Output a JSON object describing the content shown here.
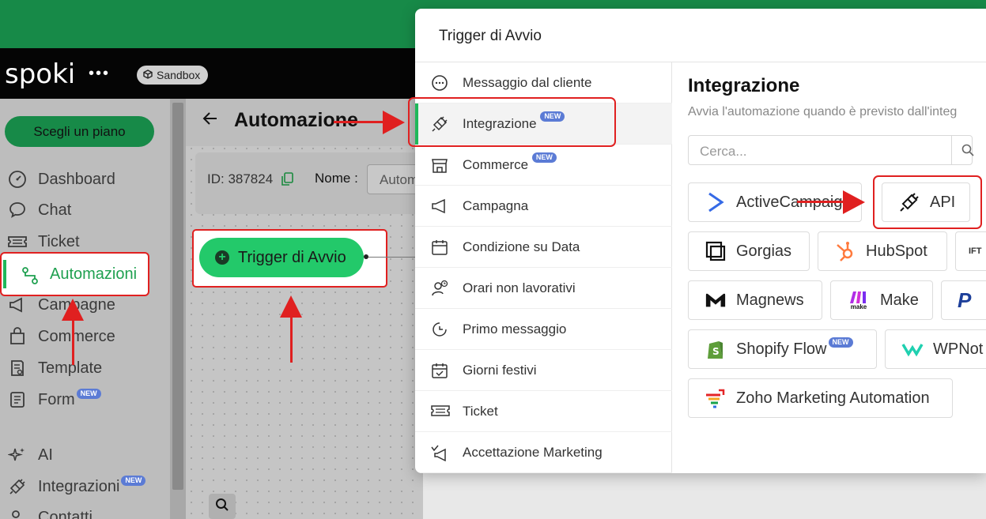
{
  "brand": {
    "logo": "spoki",
    "logo_dots": "•••",
    "env_badge": "Sandbox"
  },
  "sidebar": {
    "plan_button": "Scegli un piano",
    "items": [
      {
        "label": "Dashboard",
        "icon": "gauge-icon"
      },
      {
        "label": "Chat",
        "icon": "chat-icon"
      },
      {
        "label": "Ticket",
        "icon": "ticket-icon"
      },
      {
        "label": "Automazioni",
        "icon": "automation-icon",
        "active": true
      },
      {
        "label": "Campagne",
        "icon": "megaphone-icon"
      },
      {
        "label": "Commerce",
        "icon": "bag-icon"
      },
      {
        "label": "Template",
        "icon": "template-icon"
      },
      {
        "label": "Form",
        "icon": "form-icon",
        "badge": "NEW"
      },
      {
        "label": "AI",
        "icon": "sparkle-icon"
      },
      {
        "label": "Integrazioni",
        "icon": "plug-icon",
        "badge": "NEW"
      },
      {
        "label": "Contatti",
        "icon": "contacts-icon"
      }
    ]
  },
  "main": {
    "title": "Automazione",
    "id_label": "ID: 387824",
    "name_label": "Nome :",
    "name_value": "Autom",
    "trigger_button": "Trigger di Avvio"
  },
  "modal": {
    "title": "Trigger di Avvio",
    "triggers": [
      {
        "label": "Messaggio dal cliente",
        "icon": "chat-bubble-icon"
      },
      {
        "label": "Integrazione",
        "icon": "plug-icon",
        "badge": "NEW",
        "active": true
      },
      {
        "label": "Commerce",
        "icon": "store-icon",
        "badge": "NEW"
      },
      {
        "label": "Campagna",
        "icon": "megaphone-icon"
      },
      {
        "label": "Condizione su Data",
        "icon": "calendar-icon"
      },
      {
        "label": "Orari non lavorativi",
        "icon": "user-clock-icon"
      },
      {
        "label": "Primo messaggio",
        "icon": "clock-icon"
      },
      {
        "label": "Giorni festivi",
        "icon": "calendar-check-icon"
      },
      {
        "label": "Ticket",
        "icon": "ticket-icon"
      },
      {
        "label": "Accettazione Marketing",
        "icon": "check-megaphone-icon"
      }
    ],
    "integration": {
      "title": "Integrazione",
      "description": "Avvia l'automazione quando è previsto dall'integ",
      "search_placeholder": "Cerca...",
      "tiles": [
        {
          "label": "ActiveCampaig",
          "icon": "activecampaign-icon"
        },
        {
          "label": "API",
          "icon": "api-plug-icon"
        },
        {
          "label": "Gorgias",
          "icon": "gorgias-icon"
        },
        {
          "label": "HubSpot",
          "icon": "hubspot-icon"
        },
        {
          "label": "IFT",
          "icon": "ifttt-icon"
        },
        {
          "label": "Magnews",
          "icon": "magnews-icon"
        },
        {
          "label": "Make",
          "icon": "make-icon",
          "sublabel": "make"
        },
        {
          "label": "P",
          "icon": "paypal-icon"
        },
        {
          "label": "Shopify Flow",
          "icon": "shopify-icon",
          "badge": "NEW"
        },
        {
          "label": "WPNot",
          "icon": "wpnotif-icon"
        },
        {
          "label": "Zoho Marketing Automation",
          "icon": "zoho-icon"
        }
      ]
    }
  },
  "colors": {
    "brand_green": "#178a48",
    "active_green": "#1fb85a",
    "trigger_green": "#23c96a",
    "annotation_red": "#e02020",
    "badge_blue": "#5b7bd5"
  }
}
